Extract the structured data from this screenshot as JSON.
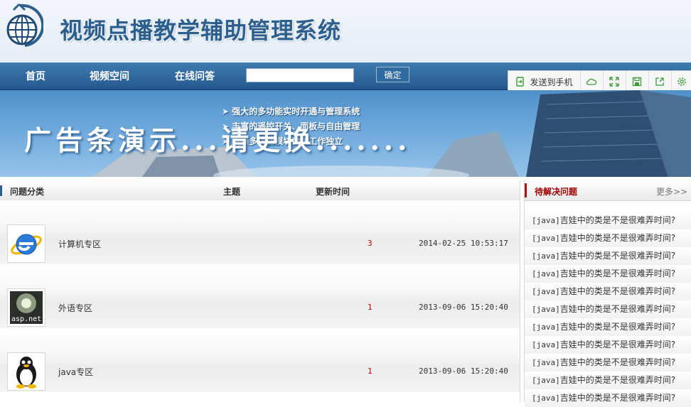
{
  "header": {
    "title": "视频点播教学辅助管理系统"
  },
  "nav": {
    "items": [
      {
        "label": "首页"
      },
      {
        "label": "视频空间"
      },
      {
        "label": "在线问答"
      }
    ],
    "search": {
      "value": "",
      "button_label": "确定"
    }
  },
  "toolbar": {
    "send_label": "发送到手机",
    "icons": [
      "send-to-phone-icon",
      "cloud-icon",
      "expand-icon",
      "save-icon",
      "share-icon",
      "settings-icon"
    ],
    "accent": "#3a9a3a"
  },
  "banner": {
    "bullets": [
      "强大的多功能实时开通与管理系统",
      "丰富的遥控开关、面板与自由管理",
      "中频多功能模块需要工作独立"
    ],
    "ad_text": "广告条演示...请更换......."
  },
  "table": {
    "headers": {
      "category": "问题分类",
      "topic": "主题",
      "updated": "更新时间"
    },
    "rows": [
      {
        "name": "计算机专区",
        "count": "3",
        "time": "2014-02-25 10:53:17",
        "icon": "ie-icon"
      },
      {
        "name": "外语专区",
        "count": "1",
        "time": "2013-09-06 15:20:40",
        "icon": "asp-net-icon"
      },
      {
        "name": "java专区",
        "count": "1",
        "time": "2013-09-06 15:20:40",
        "icon": "linux-tux-icon"
      }
    ]
  },
  "pending": {
    "title": "待解决问题",
    "more": "更多>>",
    "items": [
      {
        "tag": "[java]",
        "text": "吉娃中的类是不是很难弄时间?"
      },
      {
        "tag": "[java]",
        "text": "吉娃中的类是不是很难弄时间?"
      },
      {
        "tag": "[java]",
        "text": "吉娃中的类是不是很难弄时间?"
      },
      {
        "tag": "[java]",
        "text": "吉娃中的类是不是很难弄时间?"
      },
      {
        "tag": "[java]",
        "text": "吉娃中的类是不是很难弄时间?"
      },
      {
        "tag": "[java]",
        "text": "吉娃中的类是不是很难弄时间?"
      },
      {
        "tag": "[java]",
        "text": "吉娃中的类是不是很难弄时间?"
      },
      {
        "tag": "[java]",
        "text": "吉娃中的类是不是很难弄时间?"
      },
      {
        "tag": "[java]",
        "text": "吉娃中的类是不是很难弄时间?"
      },
      {
        "tag": "[java]",
        "text": "吉娃中的类是不是很难弄时间?"
      },
      {
        "tag": "[java]",
        "text": "吉娃中的类是不是很难弄时间?"
      }
    ]
  },
  "colors": {
    "nav_bg": "#2b649a",
    "title": "#2d5f8e",
    "pending_title": "#a10000",
    "count": "#c00000"
  }
}
